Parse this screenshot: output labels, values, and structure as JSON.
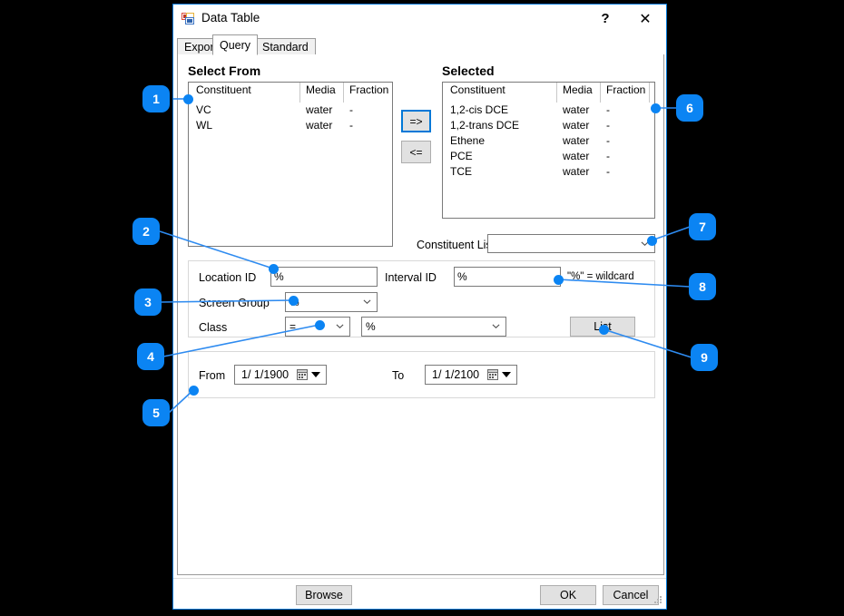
{
  "window": {
    "title": "Data Table",
    "icon": "app-window-icon",
    "help_label": "?",
    "close_label": "✕"
  },
  "tabs": [
    {
      "label": "Export",
      "active": false
    },
    {
      "label": "Query",
      "active": true
    },
    {
      "label": "Standard",
      "active": false
    }
  ],
  "select_from": {
    "group_label": "Select From",
    "columns": [
      "Constituent",
      "Media",
      "Fraction"
    ],
    "rows": [
      {
        "constituent": "VC",
        "media": "water",
        "fraction": "-"
      },
      {
        "constituent": "WL",
        "media": "water",
        "fraction": "-"
      }
    ]
  },
  "transfer": {
    "add_label": "=>",
    "remove_label": "<="
  },
  "selected": {
    "group_label": "Selected",
    "columns": [
      "Constituent",
      "Media",
      "Fraction"
    ],
    "rows": [
      {
        "constituent": "1,2-cis DCE",
        "media": "water",
        "fraction": "-"
      },
      {
        "constituent": "1,2-trans DCE",
        "media": "water",
        "fraction": "-"
      },
      {
        "constituent": "Ethene",
        "media": "water",
        "fraction": "-"
      },
      {
        "constituent": "PCE",
        "media": "water",
        "fraction": "-"
      },
      {
        "constituent": "TCE",
        "media": "water",
        "fraction": "-"
      }
    ]
  },
  "constituent_list": {
    "label": "Constituent List",
    "value": ""
  },
  "query": {
    "location_id": {
      "label": "Location ID",
      "value": "%"
    },
    "interval_id": {
      "label": "Interval ID",
      "value": "%"
    },
    "wildcard_note": "\"%\" = wildcard",
    "screen_group": {
      "label": "Screen Group",
      "value": "%"
    },
    "class": {
      "label": "Class",
      "operator": "=",
      "value": "%"
    },
    "list_button": "List"
  },
  "dates": {
    "from_label": "From",
    "from_value": "1/  1/1900",
    "to_label": "To",
    "to_value": "1/  1/2100"
  },
  "footer": {
    "browse": "Browse",
    "ok": "OK",
    "cancel": "Cancel"
  },
  "callouts": [
    {
      "number": "1"
    },
    {
      "number": "2"
    },
    {
      "number": "3"
    },
    {
      "number": "4"
    },
    {
      "number": "5"
    },
    {
      "number": "6"
    },
    {
      "number": "7"
    },
    {
      "number": "8"
    },
    {
      "number": "9"
    }
  ],
  "colors": {
    "accent": "#0b84f3",
    "focus_border": "#0078d7",
    "dialog_border": "#0078d7",
    "control_face": "#e1e1e1",
    "backdrop": "#000000"
  }
}
